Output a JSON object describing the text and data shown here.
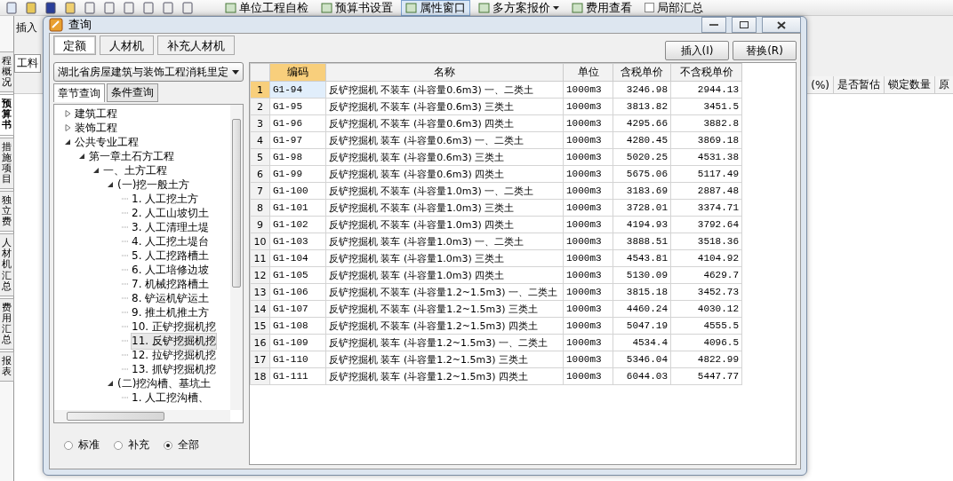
{
  "toolbar": {
    "items": [
      {
        "kind": "button",
        "label": "单位工程自检",
        "selected": false
      },
      {
        "kind": "button",
        "label": "预算书设置",
        "selected": false
      },
      {
        "kind": "button",
        "label": "属性窗口",
        "selected": true
      },
      {
        "kind": "dropdown",
        "label": "多方案报价",
        "selected": false
      },
      {
        "kind": "button",
        "label": "费用查看",
        "selected": false
      },
      {
        "kind": "checkbox",
        "label": "局部汇总",
        "checked": false
      }
    ]
  },
  "side_tabs": [
    {
      "label": "程概况",
      "selected": false
    },
    {
      "label": "预算书",
      "selected": true
    },
    {
      "label": "措施项目",
      "selected": false
    },
    {
      "label": "独立费",
      "selected": false
    },
    {
      "label": "人材机汇总",
      "selected": false
    },
    {
      "label": "费用汇总",
      "selected": false
    },
    {
      "label": "报表",
      "selected": false
    }
  ],
  "sub_toolbar": {
    "label": "插入"
  },
  "doc_tab": {
    "label": "工料"
  },
  "background_columns": [
    "(%)",
    "是否暂估",
    "锁定数量",
    "原"
  ],
  "dialog": {
    "title": "查询",
    "tabs": [
      {
        "label": "定额",
        "selected": true
      },
      {
        "label": "人材机",
        "selected": false
      },
      {
        "label": "补充人材机",
        "selected": false
      }
    ],
    "buttons": [
      "插入(I)",
      "替换(R)"
    ],
    "library": "湖北省房屋建筑与装饰工程消耗里定",
    "search_tabs": [
      {
        "label": "章节查询",
        "selected": true
      },
      {
        "label": "条件查询",
        "selected": false
      }
    ],
    "tree": [
      {
        "label": "建筑工程",
        "expanded": false,
        "selected": false
      },
      {
        "label": "装饰工程",
        "expanded": false,
        "selected": false
      },
      {
        "label": "公共专业工程",
        "expanded": true,
        "selected": false,
        "children": [
          {
            "label": "第一章土石方工程",
            "expanded": true,
            "selected": false,
            "children": [
              {
                "label": "一、土方工程",
                "expanded": true,
                "selected": false,
                "children": [
                  {
                    "label": "(一)挖一般土方",
                    "expanded": true,
                    "selected": false,
                    "children": [
                      {
                        "label": "1. 人工挖土方",
                        "selected": false
                      },
                      {
                        "label": "2. 人工山坡切土",
                        "selected": false
                      },
                      {
                        "label": "3. 人工清理土堤",
                        "selected": false
                      },
                      {
                        "label": "4. 人工挖土堤台",
                        "selected": false
                      },
                      {
                        "label": "5. 人工挖路槽土",
                        "selected": false
                      },
                      {
                        "label": "6. 人工培修边坡",
                        "selected": false
                      },
                      {
                        "label": "7. 机械挖路槽土",
                        "selected": false
                      },
                      {
                        "label": "8. 铲运机铲运土",
                        "selected": false
                      },
                      {
                        "label": "9. 推土机推土方",
                        "selected": false
                      },
                      {
                        "label": "10. 正铲挖掘机挖",
                        "selected": false
                      },
                      {
                        "label": "11. 反铲挖掘机挖",
                        "selected": true
                      },
                      {
                        "label": "12. 拉铲挖掘机挖",
                        "selected": false
                      },
                      {
                        "label": "13. 抓铲挖掘机挖",
                        "selected": false
                      }
                    ]
                  },
                  {
                    "label": "(二)挖沟槽、基坑土",
                    "expanded": true,
                    "selected": false,
                    "children": [
                      {
                        "label": "1. 人工挖沟槽、",
                        "selected": false
                      }
                    ]
                  }
                ]
              }
            ]
          }
        ]
      }
    ],
    "filters": [
      {
        "label": "标准",
        "selected": false
      },
      {
        "label": "补充",
        "selected": false
      },
      {
        "label": "全部",
        "selected": true
      }
    ],
    "table": {
      "columns": [
        "编码",
        "名称",
        "单位",
        "含税单价",
        "不含税单价"
      ],
      "rows": [
        {
          "no": "1",
          "code": "G1-94",
          "name": "反铲挖掘机 不装车 (斗容量0.6m3) 一、二类土",
          "unit": "1000m3",
          "tax_price": "3246.98",
          "price": "2944.13",
          "selected": true
        },
        {
          "no": "2",
          "code": "G1-95",
          "name": "反铲挖掘机 不装车 (斗容量0.6m3) 三类土",
          "unit": "1000m3",
          "tax_price": "3813.82",
          "price": "3451.5",
          "selected": false
        },
        {
          "no": "3",
          "code": "G1-96",
          "name": "反铲挖掘机 不装车 (斗容量0.6m3) 四类土",
          "unit": "1000m3",
          "tax_price": "4295.66",
          "price": "3882.8",
          "selected": false
        },
        {
          "no": "4",
          "code": "G1-97",
          "name": "反铲挖掘机 装车 (斗容量0.6m3) 一、二类土",
          "unit": "1000m3",
          "tax_price": "4280.45",
          "price": "3869.18",
          "selected": false
        },
        {
          "no": "5",
          "code": "G1-98",
          "name": "反铲挖掘机 装车 (斗容量0.6m3) 三类土",
          "unit": "1000m3",
          "tax_price": "5020.25",
          "price": "4531.38",
          "selected": false
        },
        {
          "no": "6",
          "code": "G1-99",
          "name": "反铲挖掘机 装车 (斗容量0.6m3) 四类土",
          "unit": "1000m3",
          "tax_price": "5675.06",
          "price": "5117.49",
          "selected": false
        },
        {
          "no": "7",
          "code": "G1-100",
          "name": "反铲挖掘机 不装车 (斗容量1.0m3) 一、二类土",
          "unit": "1000m3",
          "tax_price": "3183.69",
          "price": "2887.48",
          "selected": false
        },
        {
          "no": "8",
          "code": "G1-101",
          "name": "反铲挖掘机 不装车 (斗容量1.0m3) 三类土",
          "unit": "1000m3",
          "tax_price": "3728.01",
          "price": "3374.71",
          "selected": false
        },
        {
          "no": "9",
          "code": "G1-102",
          "name": "反铲挖掘机 不装车 (斗容量1.0m3) 四类土",
          "unit": "1000m3",
          "tax_price": "4194.93",
          "price": "3792.64",
          "selected": false
        },
        {
          "no": "10",
          "code": "G1-103",
          "name": "反铲挖掘机 装车 (斗容量1.0m3) 一、二类土",
          "unit": "1000m3",
          "tax_price": "3888.51",
          "price": "3518.36",
          "selected": false
        },
        {
          "no": "11",
          "code": "G1-104",
          "name": "反铲挖掘机 装车 (斗容量1.0m3) 三类土",
          "unit": "1000m3",
          "tax_price": "4543.81",
          "price": "4104.92",
          "selected": false
        },
        {
          "no": "12",
          "code": "G1-105",
          "name": "反铲挖掘机 装车 (斗容量1.0m3) 四类土",
          "unit": "1000m3",
          "tax_price": "5130.09",
          "price": "4629.7",
          "selected": false
        },
        {
          "no": "13",
          "code": "G1-106",
          "name": "反铲挖掘机 不装车 (斗容量1.2~1.5m3) 一、二类土",
          "unit": "1000m3",
          "tax_price": "3815.18",
          "price": "3452.73",
          "selected": false
        },
        {
          "no": "14",
          "code": "G1-107",
          "name": "反铲挖掘机 不装车 (斗容量1.2~1.5m3) 三类土",
          "unit": "1000m3",
          "tax_price": "4460.24",
          "price": "4030.12",
          "selected": false
        },
        {
          "no": "15",
          "code": "G1-108",
          "name": "反铲挖掘机 不装车 (斗容量1.2~1.5m3) 四类土",
          "unit": "1000m3",
          "tax_price": "5047.19",
          "price": "4555.5",
          "selected": false
        },
        {
          "no": "16",
          "code": "G1-109",
          "name": "反铲挖掘机 装车 (斗容量1.2~1.5m3) 一、二类土",
          "unit": "1000m3",
          "tax_price": "4534.4",
          "price": "4096.5",
          "selected": false
        },
        {
          "no": "17",
          "code": "G1-110",
          "name": "反铲挖掘机 装车 (斗容量1.2~1.5m3) 三类土",
          "unit": "1000m3",
          "tax_price": "5346.04",
          "price": "4822.99",
          "selected": false
        },
        {
          "no": "18",
          "code": "G1-111",
          "name": "反铲挖掘机 装车 (斗容量1.2~1.5m3) 四类土",
          "unit": "1000m3",
          "tax_price": "6044.03",
          "price": "5447.77",
          "selected": false
        }
      ]
    }
  }
}
